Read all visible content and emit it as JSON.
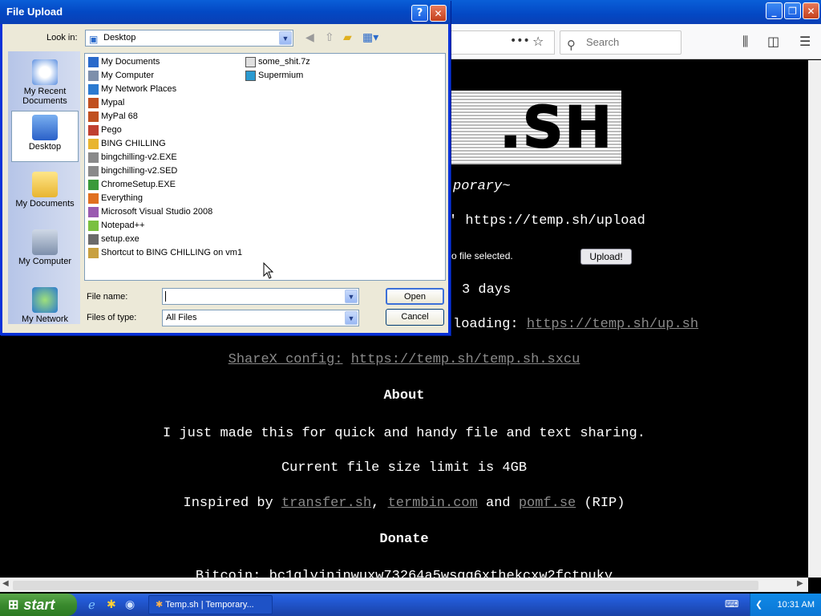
{
  "browser": {
    "search_placeholder": "Search",
    "page": {
      "logo_text": ".SH",
      "tagline": "porary~",
      "curl_line": "' https://temp.sh/upload",
      "no_file": "o file selected.",
      "upload_button": "Upload!",
      "expiry": "3 days",
      "script_label": "loading:",
      "script_link": "https://temp.sh/up.sh",
      "sharex_label": "ShareX config:",
      "sharex_link": "https://temp.sh/temp.sh.sxcu",
      "about_heading": "About",
      "about_text": "I just made this for quick and handy file and text sharing.",
      "limit_text": "Current file size limit is 4GB",
      "inspired_prefix": "Inspired by",
      "inspired_link1": "transfer.sh",
      "inspired_link2": "termbin.com",
      "inspired_and": "and",
      "inspired_link3": "pomf.se",
      "inspired_suffix": "(RIP)",
      "donate_heading": "Donate",
      "bitcoin_text": "Bitcoin: bc1qlyjnjnwuxw73264a5wsqq6xthekcxw2fctpuky"
    }
  },
  "dialog": {
    "title": "File Upload",
    "look_in_label": "Look in:",
    "look_in_value": "Desktop",
    "places": [
      {
        "label": "My Recent Documents"
      },
      {
        "label": "Desktop"
      },
      {
        "label": "My Documents"
      },
      {
        "label": "My Computer"
      },
      {
        "label": "My Network"
      }
    ],
    "files_col1": [
      "My Documents",
      "My Computer",
      "My Network Places",
      "Mypal",
      "MyPal 68",
      "Pego",
      "BING CHILLING",
      "bingchilling-v2.EXE",
      "bingchilling-v2.SED",
      "ChromeSetup.EXE",
      "Everything",
      "Microsoft Visual Studio 2008",
      "Notepad++",
      "setup.exe",
      "Shortcut to BING CHILLING on vm1"
    ],
    "files_col2": [
      "some_shit.7z",
      "Supermium"
    ],
    "file_name_label": "File name:",
    "file_name_value": "",
    "file_type_label": "Files of type:",
    "file_type_value": "All Files",
    "open_button": "Open",
    "cancel_button": "Cancel"
  },
  "taskbar": {
    "start_label": "start",
    "task_label": "Temp.sh | Temporary...",
    "clock": "10:31 AM"
  },
  "colors": {
    "xp_blue": "#0a5fd8",
    "start_green": "#3a8a2e",
    "link_gray": "#8a8a8a"
  }
}
